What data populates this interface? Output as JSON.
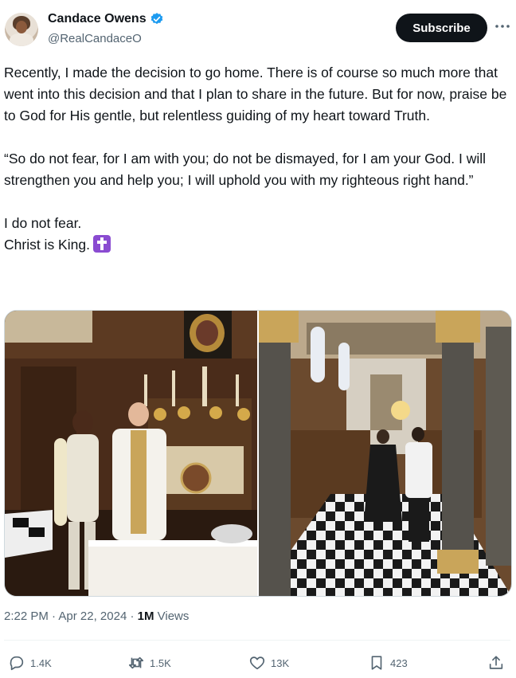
{
  "user": {
    "name": "Candace Owens",
    "handle": "@RealCandaceO",
    "verified_color": "#1d9bf0"
  },
  "header": {
    "subscribe_label": "Subscribe",
    "more_icon": "more-horizontal-icon"
  },
  "tweet": {
    "paragraphs": [
      "Recently, I made the decision to go home. There is of course so much more that went into this decision and that I plan to share in the future. But for now, praise be to God for His gentle, but relentless guiding of my heart toward Truth.",
      "“So do not fear, for I am with you; do not be dismayed, for I am your God. I will strengthen you and help you; I will uphold you with my righteous right hand.”",
      "I do not fear.",
      "Christ is King."
    ],
    "emoji": "latin-cross-emoji"
  },
  "meta": {
    "time": "2:22 PM",
    "sep1": " · ",
    "date": "Apr 22, 2024",
    "sep2": " · ",
    "views_count": "1M",
    "views_label": " Views"
  },
  "actions": {
    "replies": "1.4K",
    "reposts": "1.5K",
    "likes": "13K",
    "bookmarks": "423"
  }
}
